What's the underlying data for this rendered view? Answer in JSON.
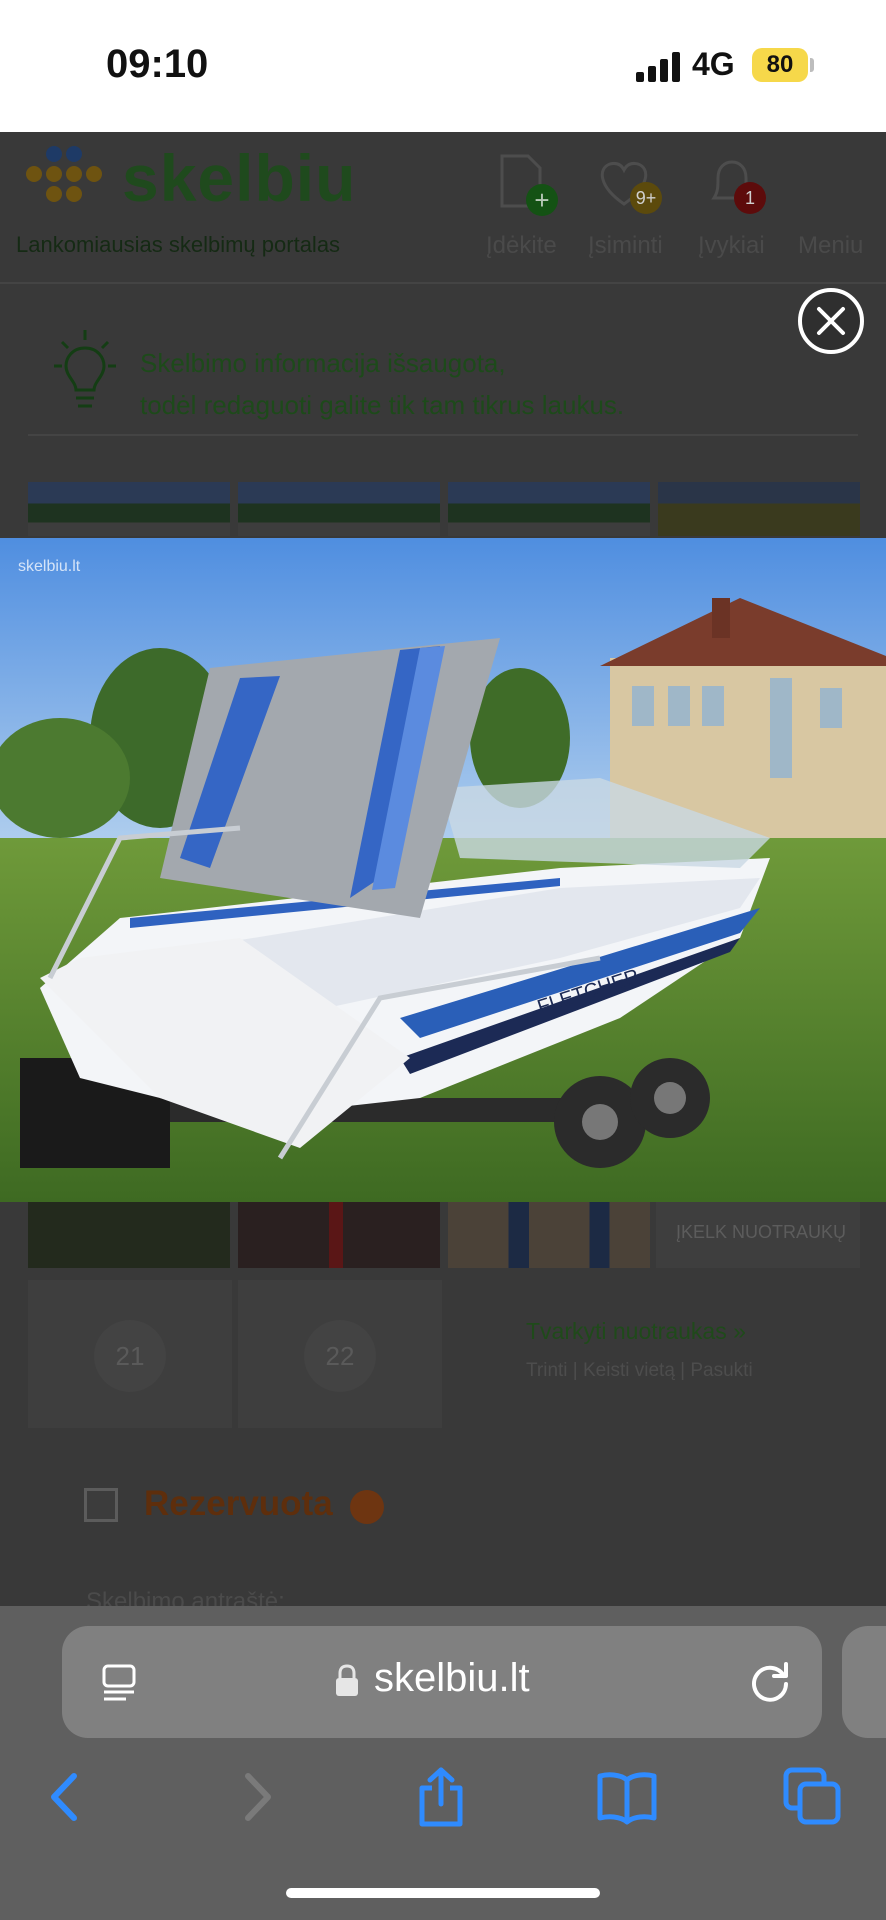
{
  "status_bar": {
    "time": "09:10",
    "network": "4G",
    "battery": "80"
  },
  "site": {
    "logo": "skelbiu",
    "tagline": "Lankomiausias skelbimų portalas",
    "nav": [
      {
        "label": "Įdėkite",
        "icon": "add-document-icon"
      },
      {
        "label": "Įsiminti",
        "icon": "heart-icon",
        "badge": "9+"
      },
      {
        "label": "Įvykiai",
        "icon": "bell-icon",
        "badge": "1"
      },
      {
        "label": "Meniu",
        "icon": "menu-icon"
      }
    ]
  },
  "notice": {
    "line1": "Skelbimo informacija išsaugota,",
    "line2": "todėl redaguoti galite tik tam tikrus laukus."
  },
  "gallery": {
    "tile_numbers": [
      "21",
      "22"
    ],
    "upload_label": "ĮKELK NUOTRAUKŲ",
    "manage_link": "Tvarkyti nuotraukas »",
    "actions": "Trinti | Keisti vietą | Pasukti"
  },
  "reserved": {
    "label": "Rezervuota"
  },
  "form": {
    "title_label": "Skelbimo antraštė:"
  },
  "viewer": {
    "watermark": "skelbiu.lt",
    "boat_brand": "FLETCHER",
    "close_icon": "close-icon"
  },
  "browser": {
    "url": "skelbiu.lt",
    "colors": {
      "accent": "#2f8bff"
    }
  }
}
